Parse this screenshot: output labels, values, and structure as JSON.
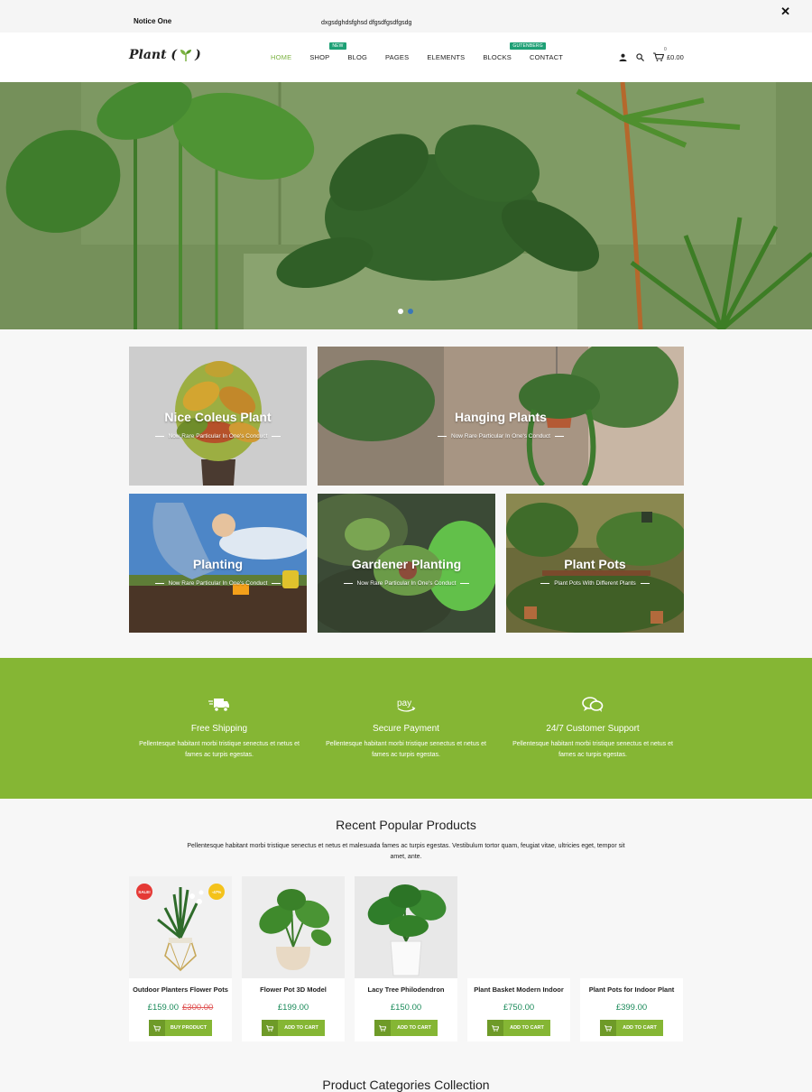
{
  "notice": {
    "title": "Notice One",
    "text": "dxgsdghdsfghsd   dfgsdfgsdfgsdg",
    "close": "✕"
  },
  "header": {
    "logo": {
      "text": "Plant (",
      "suffix": ")"
    },
    "nav": [
      {
        "label": "HOME"
      },
      {
        "label": "SHOP",
        "badge": "NEW"
      },
      {
        "label": "BLOG"
      },
      {
        "label": "PAGES"
      },
      {
        "label": "ELEMENTS"
      },
      {
        "label": "BLOCKS",
        "badge": "GUTENBERG"
      },
      {
        "label": "CONTACT"
      }
    ],
    "cart": {
      "count": "0",
      "total": "£0.00"
    }
  },
  "tiles": [
    {
      "title": "Nice Coleus Plant",
      "subtitle": "Now Rare Particular In One's Conduct"
    },
    {
      "title": "Hanging Plants",
      "subtitle": "Now Rare Particular In One's Conduct"
    },
    {
      "title": "Planting",
      "subtitle": "Now Rare Particular In One's Conduct"
    },
    {
      "title": "Gardener Planting",
      "subtitle": "Now Rare Particular In One's Conduct"
    },
    {
      "title": "Plant Pots",
      "subtitle": "Plant Pots With Different Plants"
    }
  ],
  "features": [
    {
      "title": "Free Shipping",
      "desc": "Pellentesque habitant morbi tristique senectus et netus et fames ac turpis egestas.",
      "icon": "truck-icon"
    },
    {
      "title": "Secure Payment",
      "desc": "Pellentesque habitant morbi tristique senectus et netus et fames ac turpis egestas.",
      "icon": "pay-icon"
    },
    {
      "title": "24/7 Customer Support",
      "desc": "Pellentesque habitant morbi tristique senectus et netus et fames ac turpis egestas.",
      "icon": "chat-icon"
    }
  ],
  "products_section": {
    "title": "Recent Popular Products",
    "desc": "Pellentesque habitant morbi tristique senectus et netus et malesuada fames ac turpis egestas. Vestibulum tortor quam, feugiat vitae, ultricies eget, tempor sit amet, ante."
  },
  "products": [
    {
      "name": "Outdoor Planters Flower Pots",
      "price": "£159.00",
      "old_price": "£300.00",
      "button": "BUY PRODUCT",
      "sale": "SALE!",
      "discount": "-47%"
    },
    {
      "name": "Flower Pot 3D Model",
      "price": "£199.00",
      "button": "ADD TO CART"
    },
    {
      "name": "Lacy Tree Philodendron",
      "price": "£150.00",
      "button": "ADD TO CART"
    },
    {
      "name": "Plant Basket Modern Indoor",
      "price": "£750.00",
      "button": "ADD TO CART"
    },
    {
      "name": "Plant Pots for Indoor Plant",
      "price": "£399.00",
      "button": "ADD TO CART"
    }
  ],
  "next_section": {
    "title": "Product Categories Collection"
  }
}
